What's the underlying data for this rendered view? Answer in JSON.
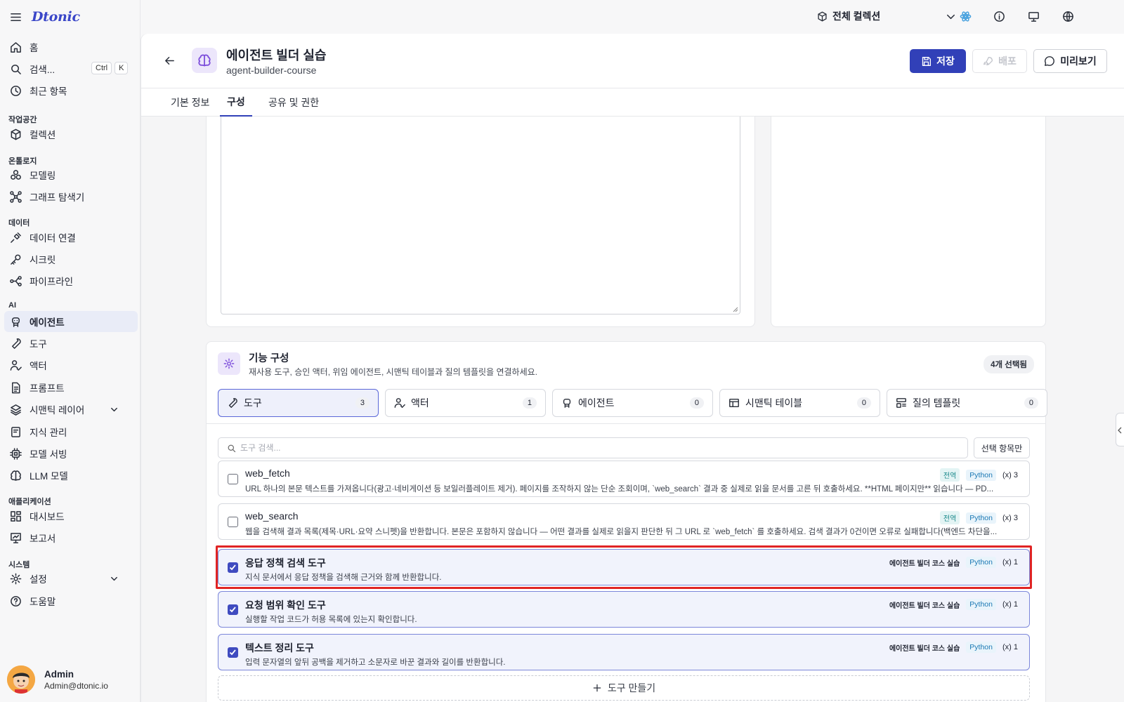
{
  "brand": {
    "logo": "Dtonic"
  },
  "sidebar": {
    "home": "홈",
    "search": "검색...",
    "search_kbd1": "Ctrl",
    "search_kbd2": "K",
    "recent": "최근 항목",
    "sec_workspace": "작업공간",
    "collections": "컬렉션",
    "sec_ontology": "온톨로지",
    "modeling": "모델링",
    "graph_explorer": "그래프 탐색기",
    "sec_data": "데이터",
    "data_connection": "데이터 연결",
    "secrets": "시크릿",
    "pipeline": "파이프라인",
    "sec_ai": "AI",
    "agents": "에이전트",
    "tools": "도구",
    "actors": "액터",
    "prompts": "프롬프트",
    "semantic_layer": "시맨틱 레이어",
    "knowledge": "지식 관리",
    "model_serving": "모델 서빙",
    "llm_models": "LLM 모델",
    "sec_apps": "애플리케이션",
    "dashboard": "대시보드",
    "reports": "보고서",
    "sec_system": "시스템",
    "settings": "설정",
    "help": "도움말",
    "user_name": "Admin",
    "user_email": "Admin@dtonic.io"
  },
  "topbar": {
    "collection_select": "전체 컬렉션"
  },
  "header": {
    "title": "에이전트 빌더 실습",
    "subtitle": "agent-builder-course",
    "save": "저장",
    "deploy": "배포",
    "preview": "미리보기"
  },
  "tabs": [
    {
      "label": "기본 정보"
    },
    {
      "label": "구성"
    },
    {
      "label": "공유 및 권한"
    }
  ],
  "feature_config": {
    "title": "기능 구성",
    "description": "재사용 도구, 승인 액터, 위임 에이전트, 시맨틱 테이블과 질의 템플릿을 연결하세요.",
    "selected_badge": "4개 선택됨",
    "categories": [
      {
        "label": "도구",
        "count": "3"
      },
      {
        "label": "액터",
        "count": "1"
      },
      {
        "label": "에이전트",
        "count": "0"
      },
      {
        "label": "시맨틱 테이블",
        "count": "0"
      },
      {
        "label": "질의 템플릿",
        "count": "0"
      }
    ],
    "search_placeholder": "도구 검색...",
    "selected_only": "선택 항목만",
    "create_tool": "도구 만들기"
  },
  "tools": [
    {
      "name": "web_fetch",
      "description": "URL 하나의 본문 텍스트를 가져옵니다(광고·네비게이션 등 보일러플레이트 제거). 페이지를 조작하지 않는 단순 조회이며, `web_search` 결과 중 실제로 읽을 문서를 고른 뒤 호출하세요. **HTML 페이지만** 읽습니다 — PD...",
      "scope": "전역",
      "lang": "Python",
      "vars": "(x) 3",
      "checked": false
    },
    {
      "name": "web_search",
      "description": "웹을 검색해 결과 목록(제목·URL·요약 스니펫)을 반환합니다. 본문은 포함하지 않습니다 — 어떤 결과를 실제로 읽을지 판단한 뒤 그 URL 로 `web_fetch` 를 호출하세요. 검색 결과가 0건이면 오류로 실패합니다(백엔드 차단을...",
      "scope": "전역",
      "lang": "Python",
      "vars": "(x) 3",
      "checked": false
    },
    {
      "name": "응답 정책 검색 도구",
      "description": "지식 문서에서 응답 정책을 검색해 근거와 함께 반환합니다.",
      "scope": "에이전트 빌더 코스 실습",
      "lang": "Python",
      "vars": "(x) 1",
      "checked": true
    },
    {
      "name": "요청 범위 확인 도구",
      "description": "실행할 작업 코드가 허용 목록에 있는지 확인합니다.",
      "scope": "에이전트 빌더 코스 실습",
      "lang": "Python",
      "vars": "(x) 1",
      "checked": true
    },
    {
      "name": "텍스트 정리 도구",
      "description": "입력 문자열의 앞뒤 공백을 제거하고 소문자로 바꾼 결과와 길이를 반환합니다.",
      "scope": "에이전트 빌더 코스 실습",
      "lang": "Python",
      "vars": "(x) 1",
      "checked": true
    }
  ],
  "colors": {
    "accent": "#3140b8",
    "highlight": "#e02424",
    "checked_bg": "#f1f3fc"
  }
}
